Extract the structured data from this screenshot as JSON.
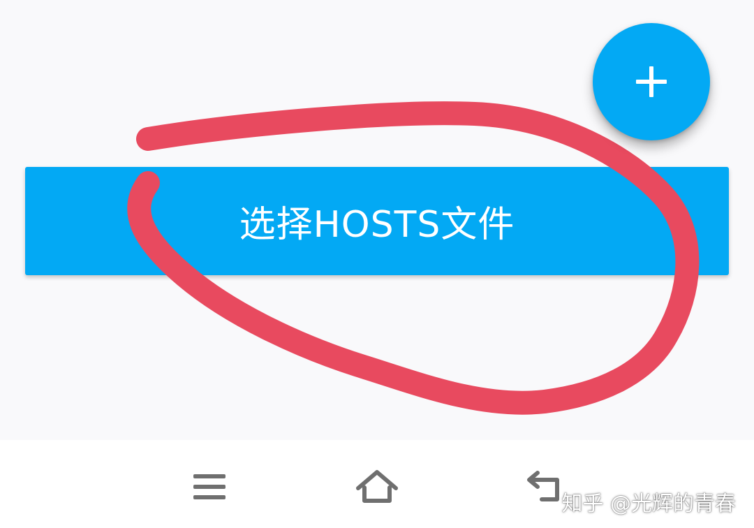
{
  "main": {
    "select_hosts_button_label": "选择HOSTS文件"
  },
  "fab": {
    "icon": "plus-icon"
  },
  "navbar": {
    "menu_icon": "menu-icon",
    "home_icon": "home-icon",
    "back_icon": "back-icon"
  },
  "watermark": {
    "text": "知乎 @光辉的青春"
  },
  "colors": {
    "accent": "#03a9f4",
    "annotation": "#e84a5f",
    "background": "#f9f9fb",
    "navbar": "#ffffff"
  }
}
